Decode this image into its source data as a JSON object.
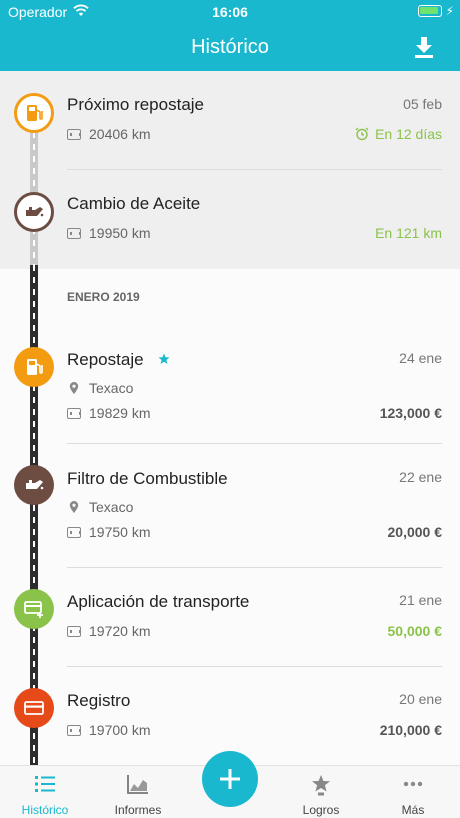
{
  "status_bar": {
    "carrier": "Operador",
    "time": "16:06"
  },
  "header": {
    "title": "Histórico",
    "download_icon": "download-icon"
  },
  "upcoming": [
    {
      "title": "Próximo repostaje",
      "date": "05 feb",
      "odometer": "20406 km",
      "eta": "En 12 días",
      "icon": "fuel-pump-icon",
      "color": "#f39c12"
    },
    {
      "title": "Cambio de Aceite",
      "odometer": "19950 km",
      "eta": "En 121 km",
      "icon": "oil-can-icon",
      "color": "#6d4c41"
    }
  ],
  "section": {
    "label": "ENERO 2019"
  },
  "entries": [
    {
      "title": "Repostaje",
      "date": "24 ene",
      "location": "Texaco",
      "odometer": "19829 km",
      "amount": "123,000 €",
      "icon": "fuel-pump-icon",
      "color": "#f39c12",
      "starred": true
    },
    {
      "title": "Filtro de Combustible",
      "date": "22 ene",
      "location": "Texaco",
      "odometer": "19750 km",
      "amount": "20,000 €",
      "icon": "oil-can-icon",
      "color": "#6d4c41"
    },
    {
      "title": "Aplicación de transporte",
      "date": "21 ene",
      "odometer": "19720 km",
      "amount": "50,000 €",
      "icon": "transport-card-icon",
      "color": "#8bc34a",
      "amount_color": "#8bc34a"
    },
    {
      "title": "Registro",
      "date": "20 ene",
      "odometer": "19700 km",
      "amount": "210,000 €",
      "icon": "card-icon",
      "color": "#e64a19"
    }
  ],
  "tabs": [
    {
      "label": "Histórico",
      "icon": "list-icon",
      "active": true
    },
    {
      "label": "Informes",
      "icon": "chart-icon"
    },
    {
      "label": "Logros",
      "icon": "trophy-star-icon"
    },
    {
      "label": "Más",
      "icon": "more-icon"
    }
  ],
  "fab": {
    "icon": "plus-icon"
  },
  "colors": {
    "accent": "#1ab8cf",
    "green": "#8bc34a"
  }
}
